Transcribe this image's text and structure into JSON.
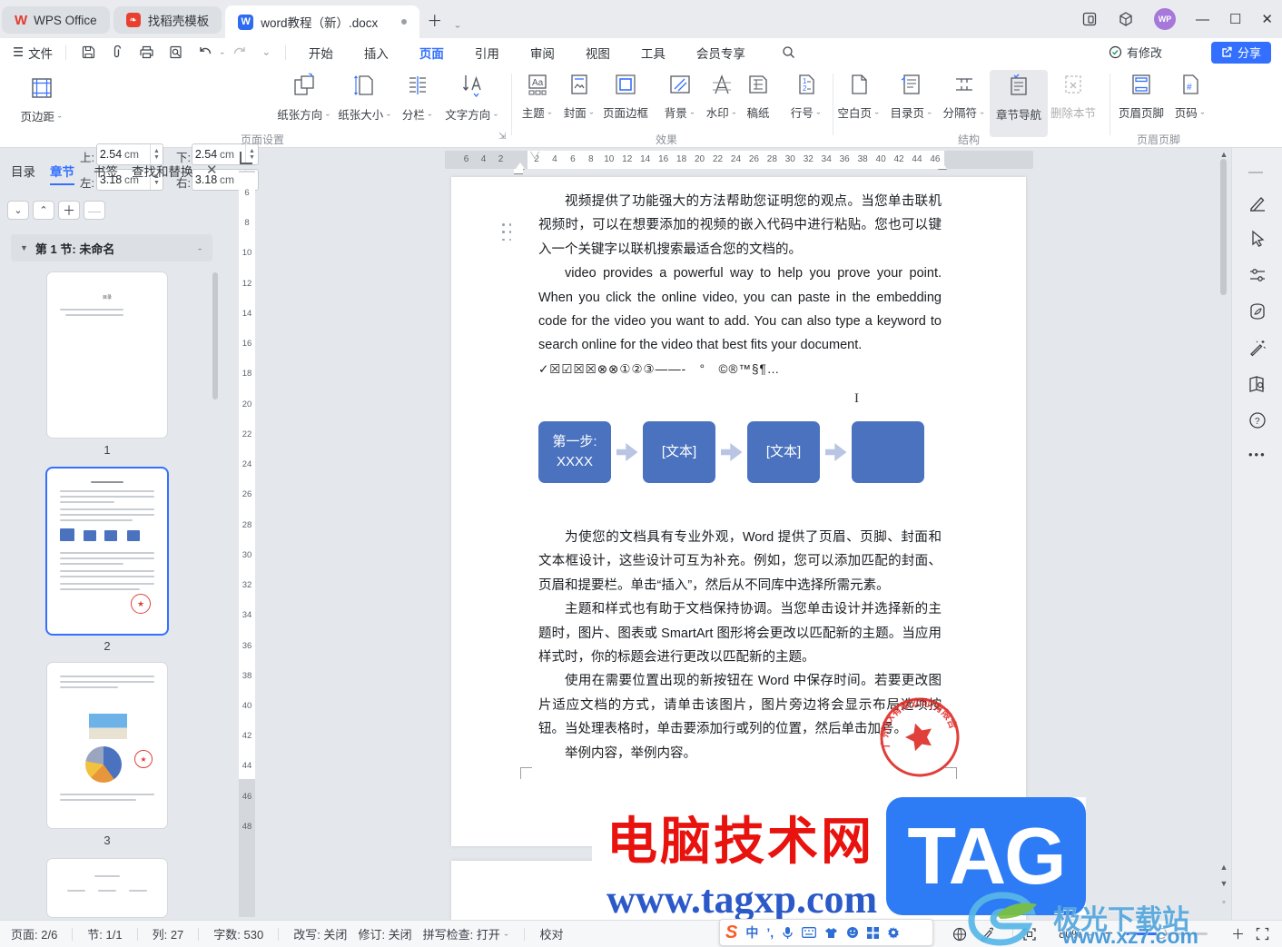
{
  "titlebar": {
    "tabs": [
      {
        "label": "WPS Office"
      },
      {
        "label": "找稻壳模板"
      },
      {
        "label": "word教程（新）.docx"
      }
    ],
    "avatar": "WP"
  },
  "menubar": {
    "file": "文件",
    "tabs": [
      "开始",
      "插入",
      "页面",
      "引用",
      "审阅",
      "视图",
      "工具",
      "会员专享"
    ],
    "active_tab": "页面",
    "modified": "有修改",
    "share": "分享"
  },
  "ribbon": {
    "margin_button": "页边距",
    "fields": [
      {
        "label": "上:",
        "value": "2.54",
        "unit": "cm"
      },
      {
        "label": "下:",
        "value": "2.54",
        "unit": "cm"
      },
      {
        "label": "左:",
        "value": "3.18",
        "unit": "cm"
      },
      {
        "label": "右:",
        "value": "3.18",
        "unit": "cm"
      }
    ],
    "page_setup_group": "页面设置",
    "orientation": "纸张方向",
    "paper_size": "纸张大小",
    "columns": "分栏",
    "text_direction": "文字方向",
    "effects": {
      "label": "效果",
      "items": [
        "主题",
        "封面",
        "页面边框",
        "背景",
        "水印",
        "稿纸",
        "行号"
      ]
    },
    "structure": {
      "label": "结构",
      "items": [
        "空白页",
        "目录页",
        "分隔符",
        "章节导航",
        "删除本节"
      ]
    },
    "header_footer": {
      "label": "页眉页脚",
      "items": [
        "页眉页脚",
        "页码"
      ]
    }
  },
  "sidebar": {
    "tabs": [
      "目录",
      "章节",
      "书签",
      "查找和替换"
    ],
    "active_tab": "章节",
    "section_header": "第 1 节: 未命名",
    "thumbnails": [
      {
        "page": "1",
        "title": "目录"
      },
      {
        "page": "2"
      },
      {
        "page": "3"
      }
    ]
  },
  "rulers": {
    "h_margin_ticks": [
      "6",
      "4",
      "2"
    ],
    "h_ticks": [
      "2",
      "4",
      "6",
      "8",
      "10",
      "12",
      "14",
      "16",
      "18",
      "20",
      "22",
      "24",
      "26",
      "28",
      "30",
      "32",
      "34",
      "36",
      "38",
      "40",
      "42",
      "44",
      "46"
    ],
    "v_ticks": [
      "6",
      "8",
      "10",
      "12",
      "14",
      "16",
      "18",
      "20",
      "22",
      "24",
      "26",
      "28",
      "30",
      "32",
      "34",
      "36",
      "38",
      "40",
      "42",
      "44",
      "46",
      "48"
    ]
  },
  "document": {
    "p1": "视频提供了功能强大的方法帮助您证明您的观点。当您单击联机视频时，可以在想要添加的视频的嵌入代码中进行粘贴。您也可以键入一个关键字以联机搜索最适合您的文档的。",
    "p2": "video provides a powerful way to help you prove your point. When you click the online video, you can paste in the embedding code for the video you want to add. You can also type a keyword to search online for the video that best fits your document.",
    "symbols": "✓☒☑☒☒⊗⊗①②③——-　°　©®™§¶…",
    "p3": "为使您的文档具有专业外观，Word 提供了页眉、页脚、封面和文本框设计，这些设计可互为补充。例如，您可以添加匹配的封面、页眉和提要栏。单击“插入”，然后从不同库中选择所需元素。",
    "p4": "主题和样式也有助于文档保持协调。当您单击设计并选择新的主题时，图片、图表或 SmartArt 图形将会更改以匹配新的主题。当应用样式时，你的标题会进行更改以匹配新的主题。",
    "p5": "使用在需要位置出现的新按钮在 Word 中保存时间。若要更改图片适应文档的方式，请单击该图片，图片旁边将会显示布局选项按钮。当处理表格时，单击要添加行或列的位置，然后单击加号。",
    "p6": "举例内容，举例内容。",
    "smartart": [
      "第一步:\nXXXX",
      "[文本]",
      "[文本]",
      ""
    ],
    "stamp_text": "广州XX有限公司(有限合伙)"
  },
  "watermarks": {
    "tag": {
      "site": "电脑技术网",
      "badge": "TAG",
      "url": "www.tagxp.com"
    },
    "xz7": {
      "site": "极光下载站",
      "url": "www.xz7.com"
    }
  },
  "statusbar": {
    "page": "页面: 2/6",
    "section": "节: 1/1",
    "column": "列: 27",
    "words": "字数: 530",
    "overwrite": "改写: 关闭",
    "track_changes": "修订: 关闭",
    "spellcheck": "拼写检查: 打开",
    "proofread": "校对",
    "zoom": "80%"
  },
  "ime": {
    "lang": "中",
    "punct": "’,"
  },
  "colors": {
    "accent": "#3370ff",
    "smartart_blue": "#4a72bf",
    "stamp_red": "#dd2b25",
    "tag_badge_blue": "#2e7cf5",
    "tag_red": "#e8120e",
    "tag_url_blue": "#2b59c8"
  }
}
